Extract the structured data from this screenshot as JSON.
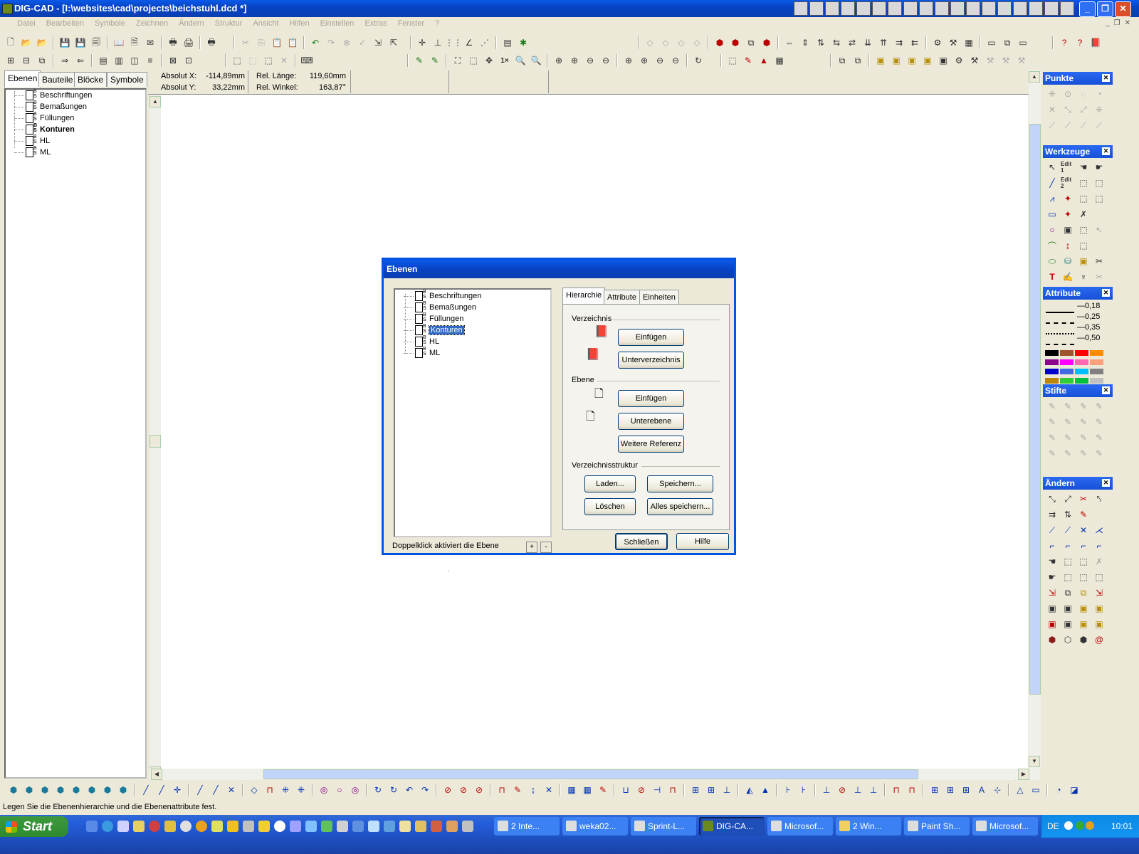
{
  "window": {
    "title": "DIG-CAD - [I:\\websites\\cad\\projects\\beichstuhl.dcd *]"
  },
  "menu": [
    "Datei",
    "Bearbeiten",
    "Symbole",
    "Zeichnen",
    "Ändern",
    "Struktur",
    "Ansicht",
    "Hilfen",
    "Einstellen",
    "Extras",
    "Fenster",
    "?"
  ],
  "left_panel": {
    "tabs": [
      "Ebenen",
      "Bauteile",
      "Blöcke",
      "Symbole"
    ],
    "layers": [
      "Beschriftungen",
      "Bemaßungen",
      "Füllungen",
      "Konturen",
      "HL",
      "ML"
    ],
    "active_layer": "Konturen"
  },
  "coords": {
    "abs_x_label": "Absolut X:",
    "abs_x": "-114,89mm",
    "abs_y_label": "Absolut Y:",
    "abs_y": "33,22mm",
    "rel_len_label": "Rel. Länge:",
    "rel_len": "119,60mm",
    "rel_angle_label": "Rel. Winkel:",
    "rel_angle": "163,87°"
  },
  "palettes": {
    "punkte": "Punkte",
    "werkzeuge": "Werkzeuge",
    "attribute": "Attribute",
    "stifte": "Stifte",
    "aendern": "Ändern",
    "line_widths": [
      "0,18",
      "0,25",
      "0,35",
      "0,50"
    ],
    "edit1": "Edit 1",
    "edit2": "Edit 2",
    "colors": [
      "#000000",
      "#a0522d",
      "#ff0000",
      "#ff8c00",
      "#8b008b",
      "#ff00ff",
      "#ff69b4",
      "#ffa07a",
      "#0000cd",
      "#4169e1",
      "#00bfff",
      "#808080",
      "#b8860b",
      "#32cd32",
      "#00c040",
      "#c0c0c0"
    ]
  },
  "dialog": {
    "title": "Ebenen",
    "tabs": [
      "Hierarchie",
      "Attribute",
      "Einheiten"
    ],
    "tree": [
      "Beschriftungen",
      "Bemaßungen",
      "Füllungen",
      "Konturen",
      "HL",
      "ML"
    ],
    "selected": "Konturen",
    "hint": "Doppelklick aktiviert die Ebene",
    "plus": "+",
    "minus": "-",
    "group_verzeichnis": "Verzeichnis",
    "btn_einfuegen1": "Einfügen",
    "btn_unterverzeichnis": "Unterverzeichnis",
    "group_ebene": "Ebene",
    "btn_einfuegen2": "Einfügen",
    "btn_unterebene": "Unterebene",
    "btn_weitere": "Weitere Referenz",
    "group_struktur": "Verzeichnisstruktur",
    "btn_laden": "Laden...",
    "btn_speichern": "Speichern...",
    "btn_loeschen": "Löschen",
    "btn_alles": "Alles speichern...",
    "btn_schliessen": "Schließen",
    "btn_hilfe": "Hilfe"
  },
  "status": "Legen Sie die Ebenenhierarchie und die Ebenenattribute fest.",
  "taskbar": {
    "start": "Start",
    "tasks": [
      "2 Inte...",
      "weka02...",
      "Sprint-L...",
      "DIG-CA...",
      "Microsof...",
      "2 Win...",
      "Paint Sh...",
      "Microsof..."
    ],
    "lang": "DE",
    "clock": "10:01"
  },
  "toolbar_zoom": "1×"
}
